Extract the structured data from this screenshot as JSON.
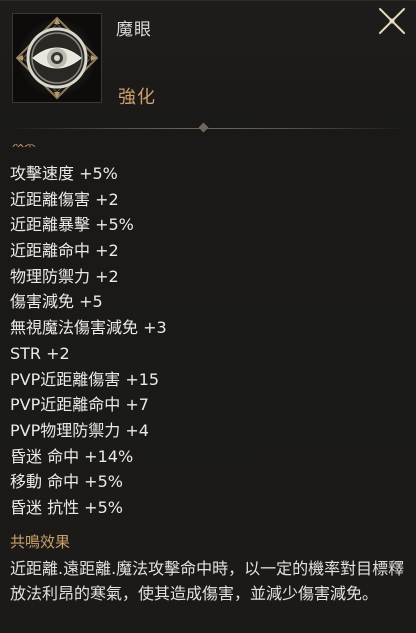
{
  "item": {
    "name": "魔眼",
    "grade": "強化",
    "icon": "eye-emblem-icon",
    "grade_color": "#c9a06a"
  },
  "close_icon": "close-icon",
  "truncated_label": "效果",
  "stats": [
    "攻擊速度 +5%",
    "近距離傷害 +2",
    "近距離暴擊 +5%",
    "近距離命中 +2",
    "物理防禦力 +2",
    "傷害減免 +5",
    "無視魔法傷害減免 +3",
    "STR +2",
    "PVP近距離傷害 +15",
    "PVP近距離命中 +7",
    "PVP物理防禦力 +4",
    "昏迷 命中 +14%",
    "移動 命中 +5%",
    "昏迷 抗性 +5%"
  ],
  "resonance": {
    "title": "共鳴效果",
    "description": "近距離.遠距離.魔法攻擊命中時，以一定的機率對目標釋放法利昂的寒氣，使其造成傷害，並減少傷害減免。"
  }
}
